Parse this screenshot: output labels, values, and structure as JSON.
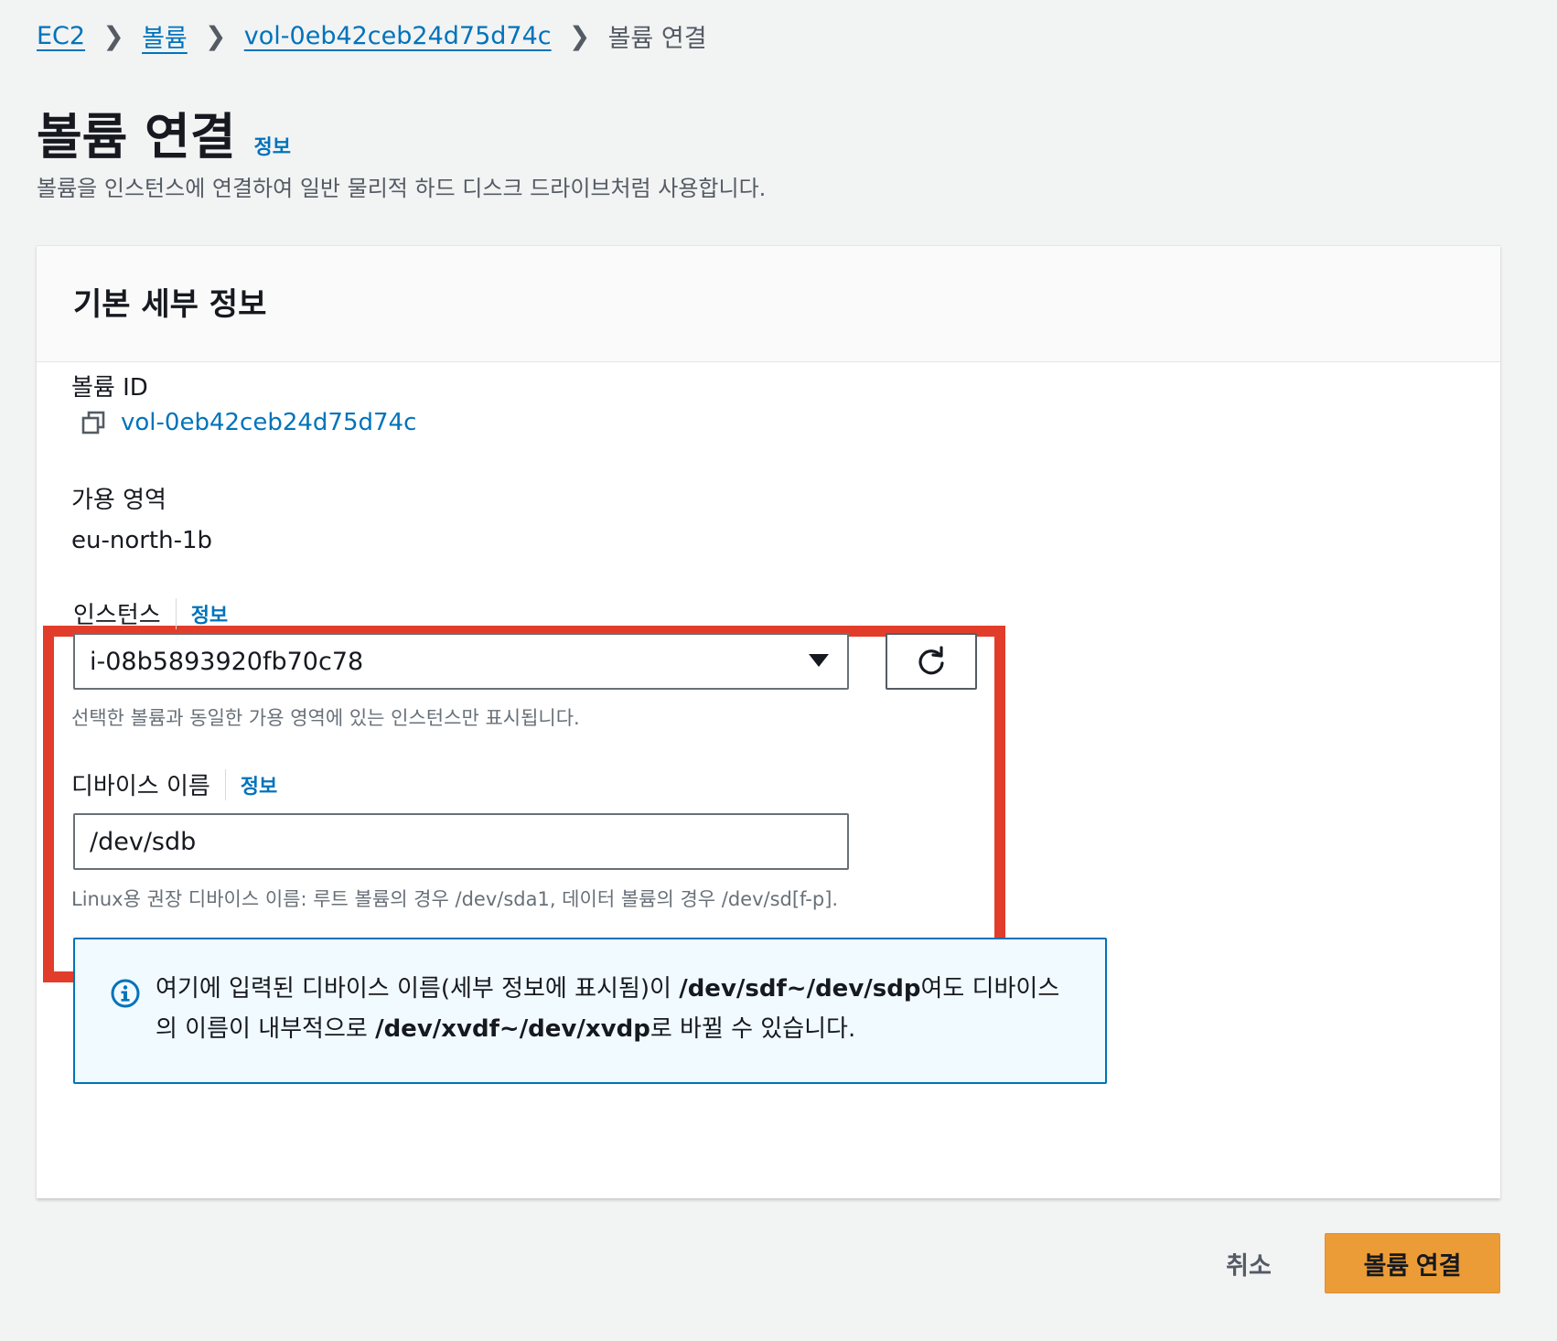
{
  "breadcrumb": {
    "items": [
      "EC2",
      "볼륨",
      "vol-0eb42ceb24d75d74c"
    ],
    "current": "볼륨 연결"
  },
  "page": {
    "title": "볼륨 연결",
    "info": "정보",
    "description": "볼륨을 인스턴스에 연결하여 일반 물리적 하드 디스크 드라이브처럼 사용합니다."
  },
  "card": {
    "title": "기본 세부 정보",
    "volume_id_label": "볼륨 ID",
    "volume_id": "vol-0eb42ceb24d75d74c",
    "az_label": "가용 영역",
    "az_value": "eu-north-1b",
    "instance": {
      "label": "인스턴스",
      "info": "정보",
      "selected": "i-08b5893920fb70c78",
      "hint": "선택한 볼륨과 동일한 가용 영역에 있는 인스턴스만 표시됩니다."
    },
    "device": {
      "label": "디바이스 이름",
      "info": "정보",
      "value": "/dev/sdb",
      "hint": "Linux용 권장 디바이스 이름: 루트 볼륨의 경우 /dev/sda1, 데이터 볼륨의 경우 /dev/sd[f-p]."
    },
    "alert": {
      "part1": "여기에 입력된 디바이스 이름(세부 정보에 표시됨)이 ",
      "bold1": "/dev/sdf~/dev/sdp",
      "part2": "여도 디바이스의 이름이 내부적으로 ",
      "bold2": "/dev/xvdf~/dev/xvdp",
      "part3": "로 바뀔 수 있습니다."
    }
  },
  "footer": {
    "cancel": "취소",
    "submit": "볼륨 연결"
  },
  "colors": {
    "link": "#0073bb",
    "primary": "#ec9c37",
    "highlight": "#e23d2a",
    "alert_bg": "#f1faff"
  }
}
